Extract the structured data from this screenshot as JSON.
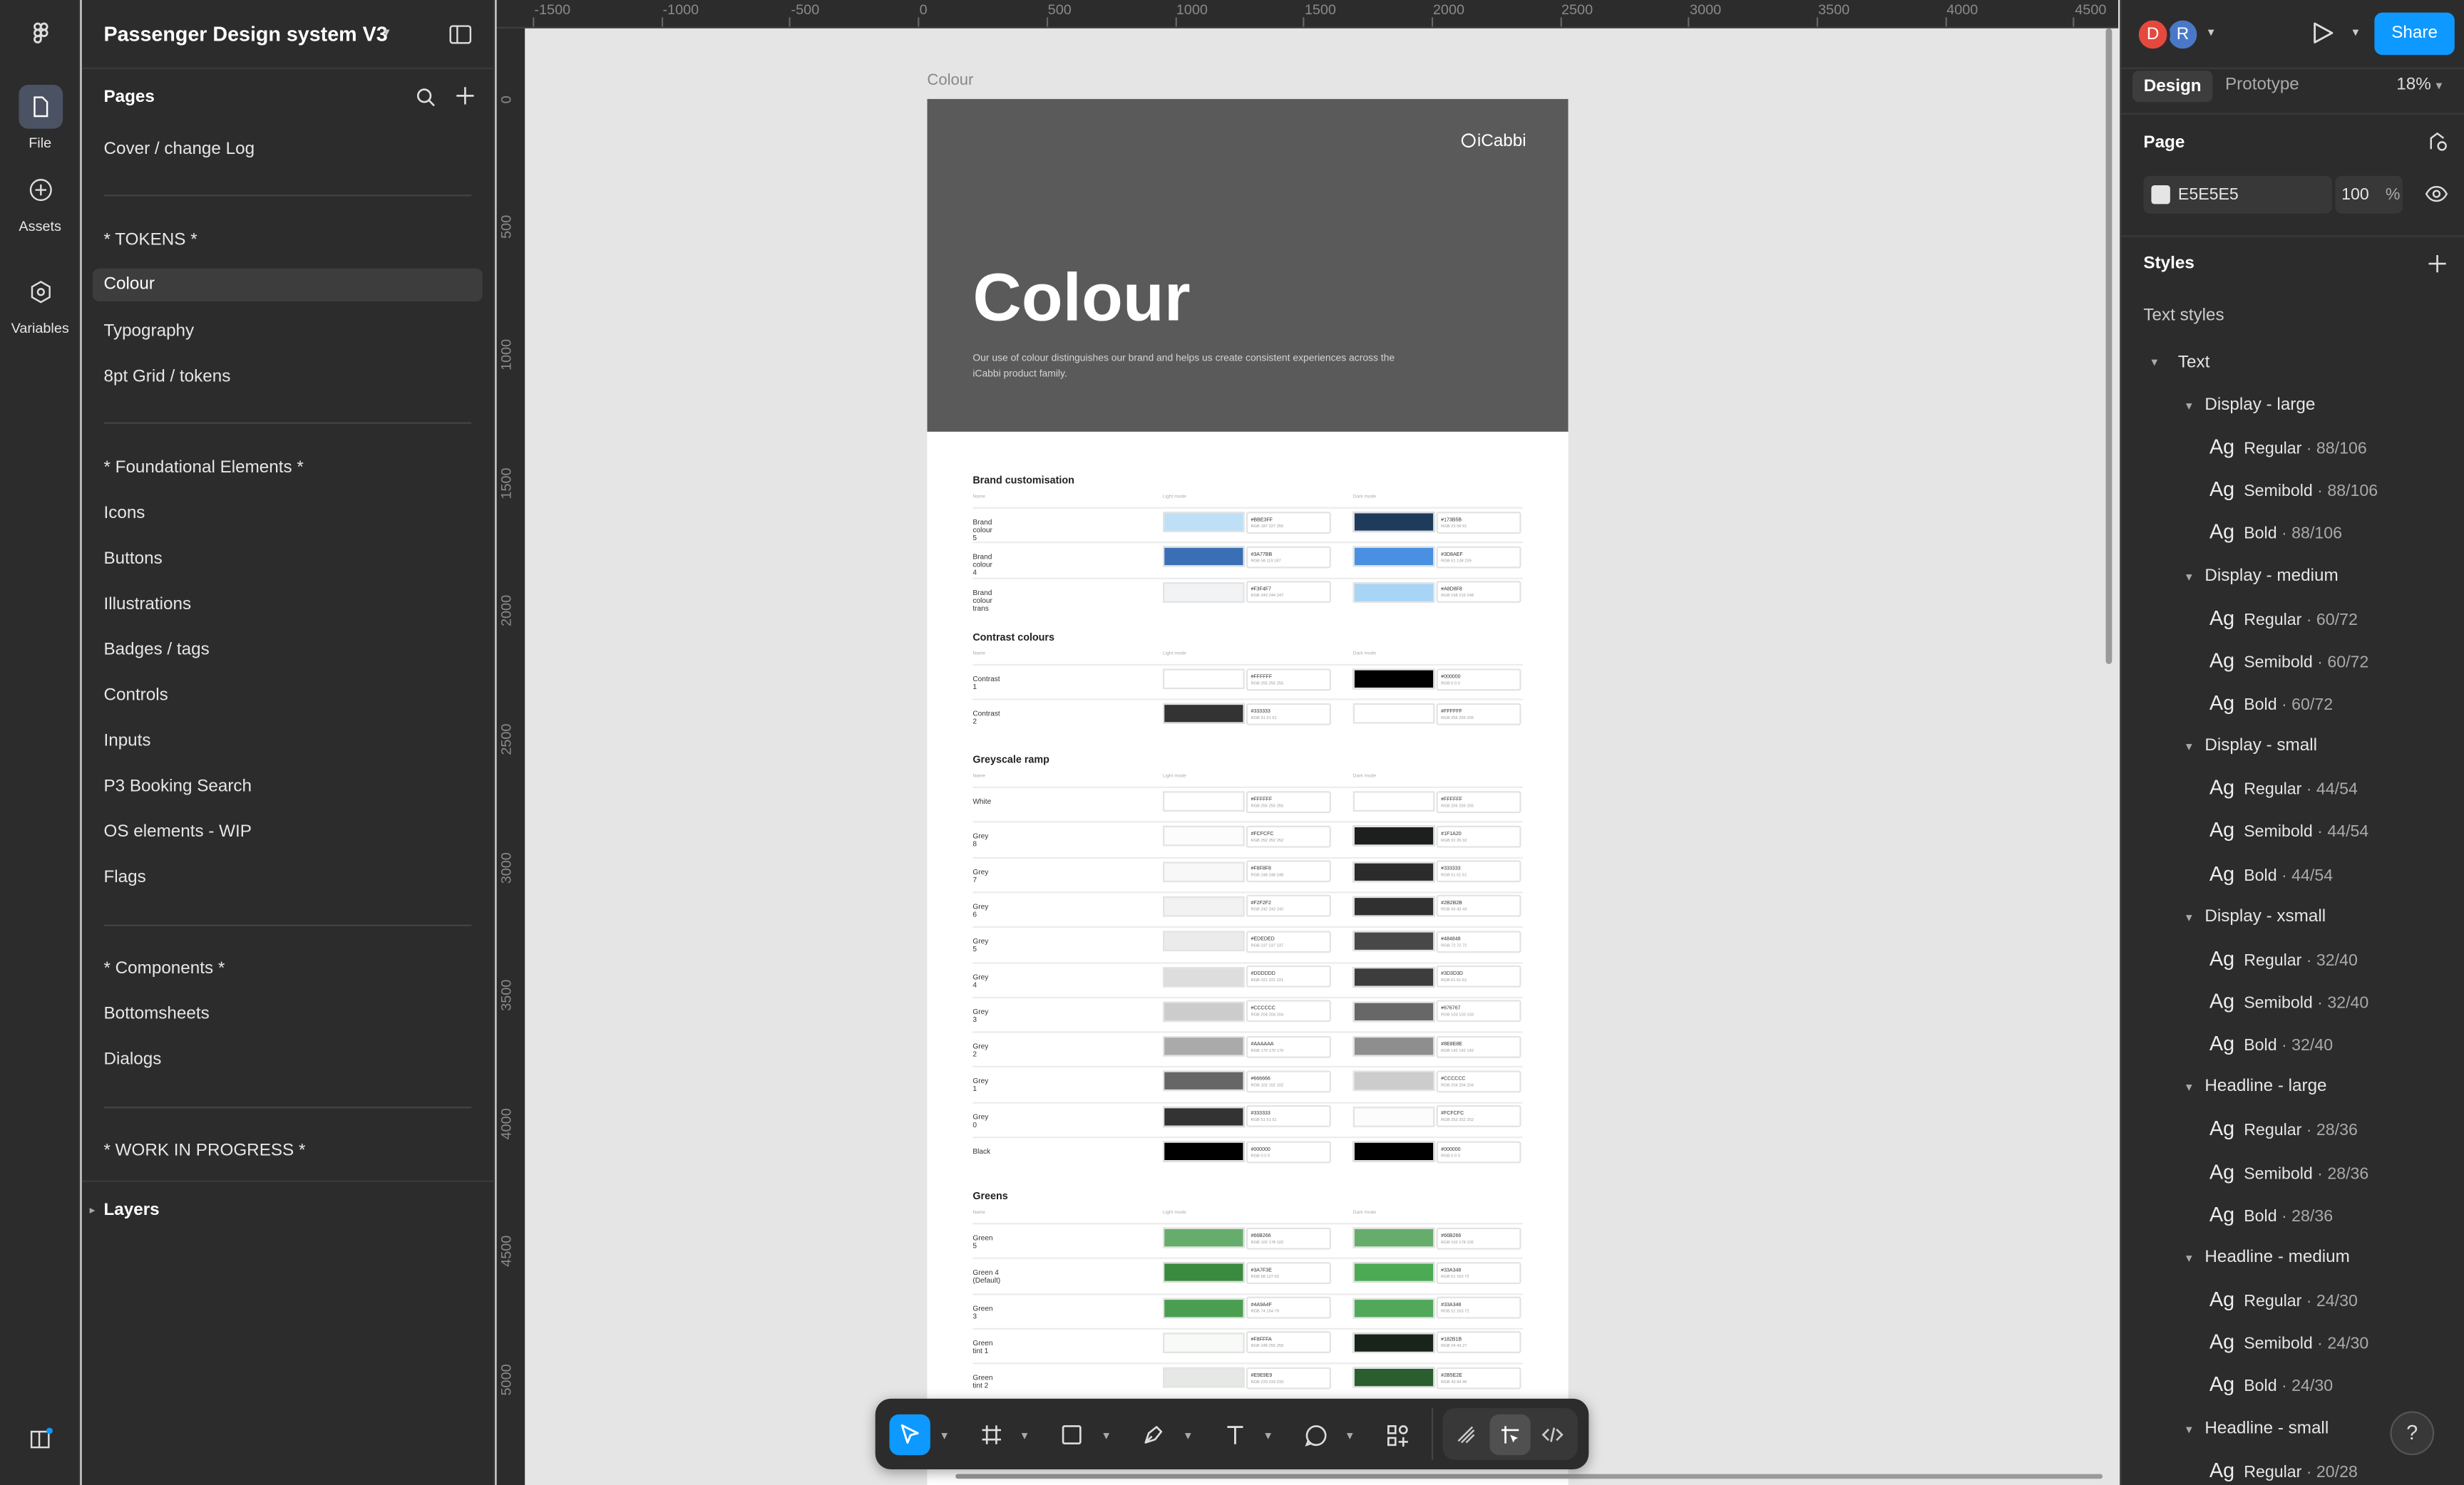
{
  "app": {
    "file_name": "Passenger Design system V3"
  },
  "rail": {
    "file": "File",
    "assets": "Assets",
    "variables": "Variables"
  },
  "pages": {
    "heading": "Pages",
    "items": [
      "Cover / change Log",
      "* TOKENS *",
      "Colour",
      "Typography",
      "8pt Grid / tokens",
      "* Foundational Elements *",
      "Icons",
      "Buttons",
      "Illustrations",
      "Badges / tags",
      "Controls",
      "Inputs",
      "P3 Booking Search",
      "OS elements - WIP",
      "Flags",
      "* Components *",
      "Bottomsheets",
      "Dialogs",
      "* WORK IN PROGRESS *"
    ],
    "selected": "Colour",
    "layers_label": "Layers"
  },
  "rulers": {
    "top": [
      "-1500",
      "-1000",
      "-500",
      "0",
      "500",
      "1000",
      "1500",
      "2000",
      "2500",
      "3000",
      "3500",
      "4000",
      "4500"
    ],
    "left": [
      "0",
      "500",
      "1000",
      "1500",
      "2000",
      "2500",
      "3000",
      "3500",
      "4000",
      "4500",
      "5000"
    ]
  },
  "frame": {
    "label": "Colour",
    "logo": "iCabbi",
    "title": "Colour",
    "intro_line1": "Our use of colour distinguishes our brand and helps us create consistent experiences across the",
    "intro_line2": "iCabbi product family.",
    "col_name": "Name",
    "col_light": "Light mode",
    "col_dark": "Dark mode",
    "sections": [
      {
        "title": "Brand customisation",
        "rows": [
          {
            "name": "Brand colour 5",
            "light": "#BBE3FF",
            "light_sub": "RGB 187 227 255",
            "light_color": "#bde0f7",
            "dark": "#173B5B",
            "dark_sub": "RGB 23 59 91",
            "dark_color": "#1f3b5c"
          },
          {
            "name": "Brand colour 4",
            "light": "#3A77BB",
            "light_sub": "RGB 58 119 187",
            "light_color": "#3a6fb5",
            "dark": "#3D8AEF",
            "dark_sub": "RGB 61 138 239",
            "dark_color": "#4a90e2"
          },
          {
            "name": "Brand colour trans",
            "light": "#F3F4F7",
            "light_sub": "RGB 243 244 247",
            "light_color": "#f2f3f5",
            "dark": "#A8D8F8",
            "dark_sub": "RGB 168 216 248",
            "dark_color": "#a8d4f5"
          }
        ]
      },
      {
        "title": "Contrast colours",
        "rows": [
          {
            "name": "Contrast 1",
            "light": "#FFFFFF",
            "light_sub": "RGB 255 255 255",
            "light_color": "#ffffff",
            "dark": "#000000",
            "dark_sub": "RGB 0 0 0",
            "dark_color": "#000000"
          },
          {
            "name": "Contrast 2",
            "light": "#333333",
            "light_sub": "RGB 51 51 51",
            "light_color": "#333333",
            "dark": "#FFFFFF",
            "dark_sub": "RGB 255 255 255",
            "dark_color": "#ffffff"
          }
        ]
      },
      {
        "title": "Greyscale ramp",
        "rows": [
          {
            "name": "White",
            "light": "#FFFFFF",
            "light_sub": "RGB 255 255 255",
            "light_color": "#ffffff",
            "dark": "#FFFFFF",
            "dark_sub": "RGB 255 255 255",
            "dark_color": "#ffffff"
          },
          {
            "name": "Grey 8",
            "light": "#FCFCFC",
            "light_sub": "RGB 252 252 252",
            "light_color": "#fcfcfc",
            "dark": "#1F1A20",
            "dark_sub": "RGB 31 26 32",
            "dark_color": "#1c1f1d"
          },
          {
            "name": "Grey 7",
            "light": "#F8F8F8",
            "light_sub": "RGB 248 248 248",
            "light_color": "#f8f8f8",
            "dark": "#333333",
            "dark_sub": "RGB 51 51 51",
            "dark_color": "#2b2b2b"
          },
          {
            "name": "Grey 6",
            "light": "#F2F2F2",
            "light_sub": "RGB 242 242 242",
            "light_color": "#f2f2f2",
            "dark": "#2B2B2B",
            "dark_sub": "RGB 43 43 43",
            "dark_color": "#303030"
          },
          {
            "name": "Grey 5",
            "light": "#EDEDED",
            "light_sub": "RGB 237 237 237",
            "light_color": "#ebebeb",
            "dark": "#484848",
            "dark_sub": "RGB 72 72 72",
            "dark_color": "#484848"
          },
          {
            "name": "Grey 4",
            "light": "#DDDDDD",
            "light_sub": "RGB 221 221 221",
            "light_color": "#dddddd",
            "dark": "#3D3D3D",
            "dark_sub": "RGB 61 61 61",
            "dark_color": "#3d3d3d"
          },
          {
            "name": "Grey 3",
            "light": "#CCCCCC",
            "light_sub": "RGB 204 204 204",
            "light_color": "#cccccc",
            "dark": "#676767",
            "dark_sub": "RGB 103 103 103",
            "dark_color": "#676767"
          },
          {
            "name": "Grey 2",
            "light": "#AAAAAA",
            "light_sub": "RGB 170 170 170",
            "light_color": "#aaaaaa",
            "dark": "#8E8E8E",
            "dark_sub": "RGB 142 142 142",
            "dark_color": "#8e8e8e"
          },
          {
            "name": "Grey 1",
            "light": "#666666",
            "light_sub": "RGB 102 102 102",
            "light_color": "#666666",
            "dark": "#CCCCCC",
            "dark_sub": "RGB 204 204 204",
            "dark_color": "#cccccc"
          },
          {
            "name": "Grey 0",
            "light": "#333333",
            "light_sub": "RGB 51 51 51",
            "light_color": "#333333",
            "dark": "#FCFCFC",
            "dark_sub": "RGB 252 252 252",
            "dark_color": "#fcfcfc"
          },
          {
            "name": "Black",
            "light": "#000000",
            "light_sub": "RGB 0 0 0",
            "light_color": "#000000",
            "dark": "#000000",
            "dark_sub": "RGB 0 0 0",
            "dark_color": "#000000"
          }
        ]
      },
      {
        "title": "Greens",
        "rows": [
          {
            "name": "Green 5",
            "light": "#66B266",
            "light_sub": "RGB 102 178 102",
            "light_color": "#66ad6c",
            "dark": "#66B266",
            "dark_sub": "RGB 102 178 102",
            "dark_color": "#66ad6c"
          },
          {
            "name": "Green 4 (Default)",
            "light": "#3A7F3E",
            "light_sub": "RGB 58 127 62",
            "light_color": "#3a8a3f",
            "dark": "#33A348",
            "dark_sub": "RGB 51 163 72",
            "dark_color": "#4caa55"
          },
          {
            "name": "Green 3",
            "light": "#4A9A4F",
            "light_sub": "RGB 74 154 79",
            "light_color": "#4a9e50",
            "dark": "#33A348",
            "dark_sub": "RGB 51 163 72",
            "dark_color": "#52a85a"
          },
          {
            "name": "Green tint 1",
            "light": "#F8FFFA",
            "light_sub": "RGB 248 255 250",
            "light_color": "#f7faf7",
            "dark": "#182B1B",
            "dark_sub": "RGB 24 43 27",
            "dark_color": "#18231a"
          },
          {
            "name": "Green tint 2",
            "light": "#E9E9E9",
            "light_sub": "RGB 233 233 233",
            "light_color": "#e5e8e5",
            "dark": "#2B5E2E",
            "dark_sub": "RGB 43 94 46",
            "dark_color": "#2b5e2e"
          }
        ]
      }
    ]
  },
  "header_right": {
    "avatar1": "D",
    "avatar2": "R",
    "share": "Share"
  },
  "design_panel": {
    "tab_design": "Design",
    "tab_prototype": "Prototype",
    "zoom": "18%",
    "page_section": "Page",
    "page_color": "E5E5E5",
    "page_opacity": "100",
    "percent": "%",
    "styles": "Styles",
    "text_styles": "Text styles",
    "text_group": "Text",
    "groups": [
      {
        "name": "Display - large",
        "items": [
          {
            "weight": "Regular",
            "size": "88/106"
          },
          {
            "weight": "Semibold",
            "size": "88/106"
          },
          {
            "weight": "Bold",
            "size": "88/106"
          }
        ]
      },
      {
        "name": "Display - medium",
        "items": [
          {
            "weight": "Regular",
            "size": "60/72"
          },
          {
            "weight": "Semibold",
            "size": "60/72"
          },
          {
            "weight": "Bold",
            "size": "60/72"
          }
        ]
      },
      {
        "name": "Display - small",
        "items": [
          {
            "weight": "Regular",
            "size": "44/54"
          },
          {
            "weight": "Semibold",
            "size": "44/54"
          },
          {
            "weight": "Bold",
            "size": "44/54"
          }
        ]
      },
      {
        "name": "Display - xsmall",
        "items": [
          {
            "weight": "Regular",
            "size": "32/40"
          },
          {
            "weight": "Semibold",
            "size": "32/40"
          },
          {
            "weight": "Bold",
            "size": "32/40"
          }
        ]
      },
      {
        "name": "Headline - large",
        "items": [
          {
            "weight": "Regular",
            "size": "28/36"
          },
          {
            "weight": "Semibold",
            "size": "28/36"
          },
          {
            "weight": "Bold",
            "size": "28/36"
          }
        ]
      },
      {
        "name": "Headline - medium",
        "items": [
          {
            "weight": "Regular",
            "size": "24/30"
          },
          {
            "weight": "Semibold",
            "size": "24/30"
          },
          {
            "weight": "Bold",
            "size": "24/30"
          }
        ]
      },
      {
        "name": "Headline - small",
        "items": [
          {
            "weight": "Regular",
            "size": "20/28"
          }
        ]
      }
    ],
    "ag": "Ag",
    "help": "?"
  },
  "colors": {
    "accent": "#0d99ff",
    "panel": "#2c2c2c",
    "avatar_d": "#e5483d",
    "avatar_r": "#4a78c9"
  }
}
